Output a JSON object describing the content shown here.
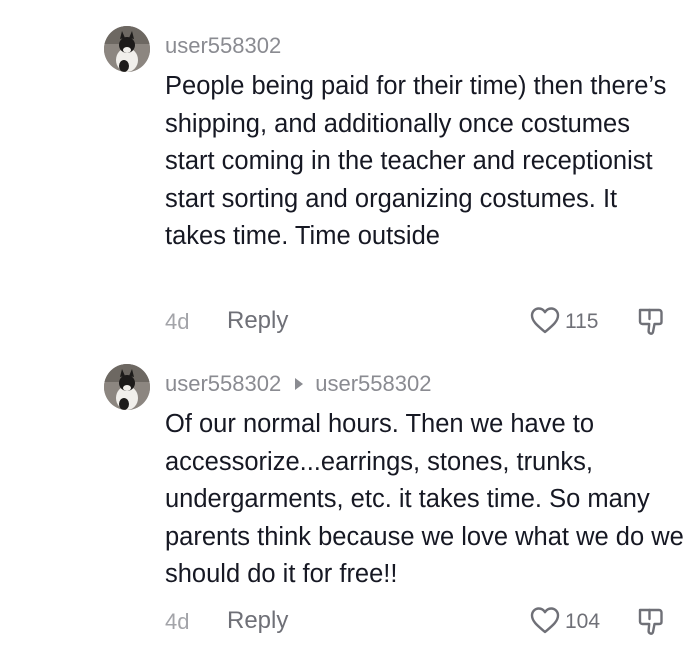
{
  "comments": [
    {
      "author": "user558302",
      "reply_to": "",
      "text": "People being paid for their time) then there’s shipping, and additionally once costumes start coming in the teacher and receptionist start sorting and organizing costumes. It takes time. Time outside",
      "time": "4d",
      "reply_label": "Reply",
      "likes": "115"
    },
    {
      "author": "user558302",
      "reply_to": "user558302",
      "text": "Of our normal hours. Then we have to accessorize...earrings, stones, trunks, undergarments, etc. it takes time. So many parents think because we love what we do we should do it for free!!",
      "time": "4d",
      "reply_label": "Reply",
      "likes": "104"
    }
  ],
  "icons": {
    "like": "heart-outline-icon",
    "dislike": "thumbs-down-outline-icon",
    "reply_to": "triangle-right-icon"
  },
  "colors": {
    "text": "#161823",
    "muted": "#8a8b91",
    "icon": "#6f7077"
  }
}
